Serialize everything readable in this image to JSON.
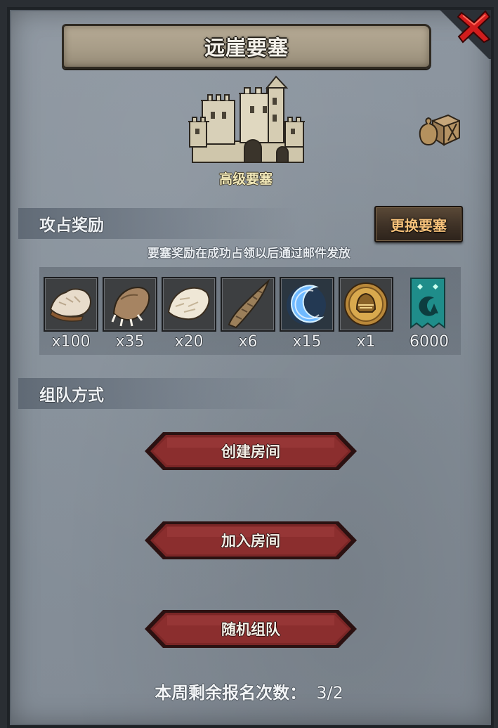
{
  "title": "远崖要塞",
  "fortress": {
    "label": "高级要塞"
  },
  "rewards_section": {
    "title": "攻占奖励",
    "change_button": "更换要塞",
    "notice": "要塞奖励在成功占领以后通过邮件发放",
    "items": [
      {
        "icon": "fur-pelt-icon",
        "count": "x100"
      },
      {
        "icon": "claw-icon",
        "count": "x35"
      },
      {
        "icon": "white-fur-icon",
        "count": "x20"
      },
      {
        "icon": "horn-icon",
        "count": "x6"
      },
      {
        "icon": "crescent-moon-icon",
        "count": "x15"
      },
      {
        "icon": "golden-helmet-medal-icon",
        "count": "x1"
      },
      {
        "icon": "guild-banner-icon",
        "count": "6000"
      }
    ]
  },
  "team_section": {
    "title": "组队方式",
    "buttons": [
      "创建房间",
      "加入房间",
      "随机组队"
    ]
  },
  "footer": {
    "label": "本周剩余报名次数：",
    "value": "3/2"
  },
  "colors": {
    "panel": "#86909a",
    "button_red": "#7a2626",
    "accent_gold": "#f6c17a",
    "close_red": "#d11d1d"
  }
}
